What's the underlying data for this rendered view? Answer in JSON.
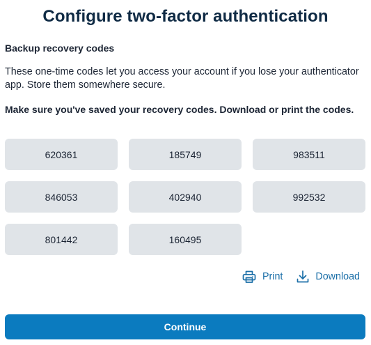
{
  "page": {
    "title": "Configure two-factor authentication"
  },
  "section": {
    "title": "Backup recovery codes",
    "description": "These one-time codes let you access your account if you lose your authenticator app. Store them somewhere secure.",
    "warning": "Make sure you've saved your recovery codes. Download or print the codes."
  },
  "codes": [
    "620361",
    "185749",
    "983511",
    "846053",
    "402940",
    "992532",
    "801442",
    "160495"
  ],
  "actions": {
    "print_label": "Print",
    "print_icon": "printer-icon",
    "download_label": "Download",
    "download_icon": "download-icon"
  },
  "continue_label": "Continue",
  "colors": {
    "accent": "#0b7bbf",
    "link": "#1b6fa8",
    "code_chip_bg": "#e0e4e8",
    "title": "#0f2a44"
  }
}
